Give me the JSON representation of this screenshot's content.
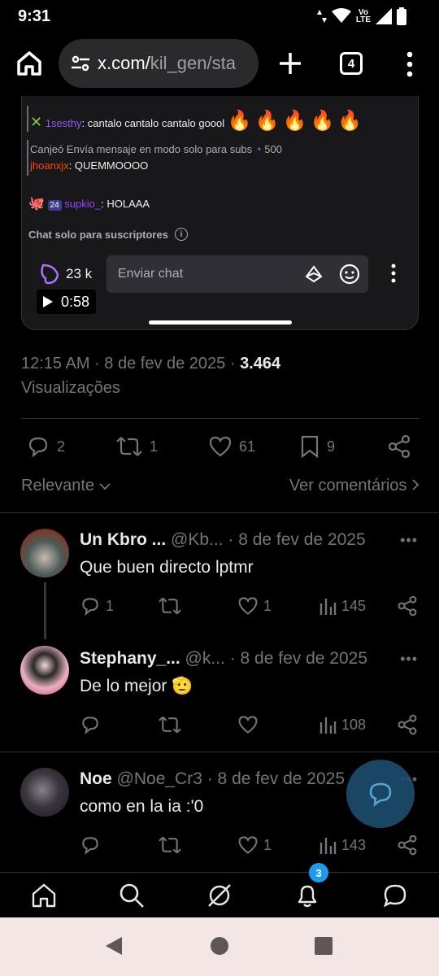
{
  "status": {
    "time": "9:31",
    "lte_top": "Vo",
    "lte_bottom": "LTE"
  },
  "browser": {
    "url_domain": "x.com/",
    "url_path": "kil_gen/sta",
    "tab_count": "4"
  },
  "video": {
    "chat_lines": [
      {
        "user": "1sesthy",
        "text": ": cantalo cantalo cantalo goool",
        "emoji": "🔥🔥🔥🔥🔥"
      },
      {
        "prefix": "Canjeó Envía mensaje en modo solo para subs",
        "points": "500"
      },
      {
        "user": "jhoanxjx",
        "text": ": QUEMMOOOO"
      },
      {
        "badge_text": "24",
        "user": "supkio_",
        "text": ": HOLAAA"
      }
    ],
    "subs_only_label": "Chat solo para suscriptores",
    "viewer_count": "23 k",
    "chat_placeholder": "Enviar chat",
    "duration": "0:58"
  },
  "meta": {
    "time_date": "12:15 AM · 8 de fev de 2025 · ",
    "views_count": "3.464",
    "views_label": "Visualizações"
  },
  "actions": {
    "replies": "2",
    "reposts": "1",
    "likes": "61",
    "bookmarks": "9"
  },
  "sort": {
    "left": "Relevante",
    "right": "Ver comentários"
  },
  "replies": [
    {
      "name": "Un Kbro ...",
      "handle": "@Kb...",
      "date": "· 8 de fev de 2025",
      "text": "Que buen directo lptmr",
      "replies": "1",
      "likes": "1",
      "views": "145"
    },
    {
      "name": "Stephany_...",
      "handle": "@k...",
      "date": "· 8 de fev de 2025",
      "text": "De lo mejor",
      "emoji": "🫡",
      "views": "108"
    },
    {
      "name": "Noe",
      "handle": "@Noe_Cr3",
      "date": "· 8 de fev de 2025",
      "text": "como en la ia :'0",
      "likes": "1",
      "views": "143"
    }
  ],
  "nav": {
    "notif_badge": "3"
  },
  "colors": {
    "accent": "#1d9bf0",
    "twitch_purple": "#8b5cf6",
    "bg": "#000000"
  }
}
